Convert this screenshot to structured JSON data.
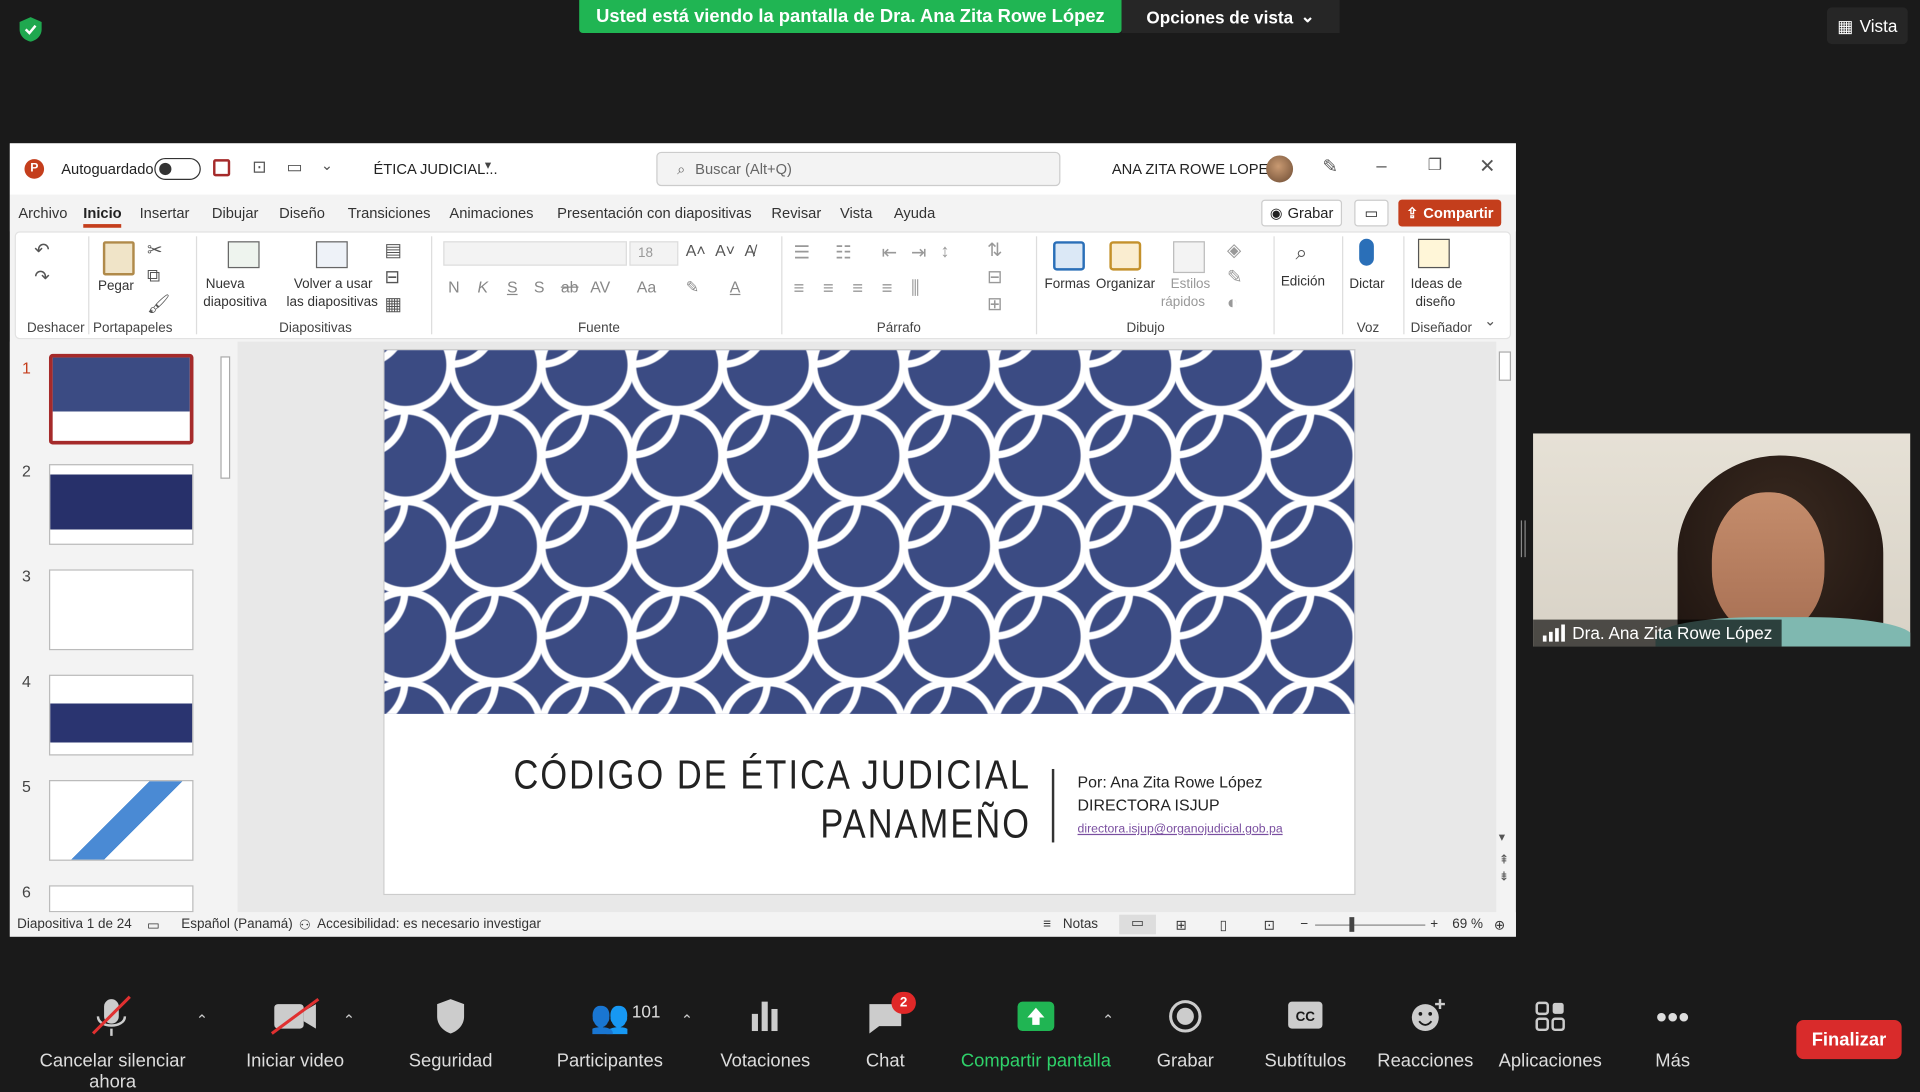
{
  "zoom": {
    "banner_text": "Usted está viendo la pantalla de Dra. Ana Zita Rowe López",
    "view_options": "Opciones de vista",
    "vista": "Vista",
    "participant_name": "Dra. Ana Zita Rowe López",
    "toolbar": [
      {
        "label": "Cancelar silenciar ahora",
        "icon": "mic-muted-icon"
      },
      {
        "label": "Iniciar video",
        "icon": "video-off-icon"
      },
      {
        "label": "Seguridad",
        "icon": "shield-icon"
      },
      {
        "label": "Participantes",
        "icon": "participants-icon",
        "count": "101"
      },
      {
        "label": "Votaciones",
        "icon": "poll-icon"
      },
      {
        "label": "Chat",
        "icon": "chat-icon",
        "badge": "2"
      },
      {
        "label": "Compartir pantalla",
        "icon": "share-screen-icon"
      },
      {
        "label": "Grabar",
        "icon": "record-icon"
      },
      {
        "label": "Subtítulos",
        "icon": "cc-icon"
      },
      {
        "label": "Reacciones",
        "icon": "reactions-icon"
      },
      {
        "label": "Aplicaciones",
        "icon": "apps-icon"
      },
      {
        "label": "Más",
        "icon": "more-icon"
      }
    ],
    "end_button": "Finalizar",
    "colors": {
      "share_green": "#20b553",
      "end_red": "#d92b2b"
    }
  },
  "ppt": {
    "autosave": "Autoguardado",
    "doc_title": "ÉTICA JUDICIAL...",
    "search_placeholder": "Buscar (Alt+Q)",
    "user": "ANA ZITA  ROWE LOPEZ",
    "menu": [
      "Archivo",
      "Inicio",
      "Insertar",
      "Dibujar",
      "Diseño",
      "Transiciones",
      "Animaciones",
      "Presentación con diapositivas",
      "Revisar",
      "Vista",
      "Ayuda"
    ],
    "grabar": "Grabar",
    "compartir": "Compartir",
    "ribbon": {
      "groups": [
        "Deshacer",
        "Portapapeles",
        "Diapositivas",
        "Fuente",
        "Párrafo",
        "Dibujo",
        "Voz",
        "Diseñador"
      ],
      "pegar": "Pegar",
      "nueva": "Nueva",
      "diapositiva": "diapositiva",
      "volver1": "Volver a usar",
      "volver2": "las diapositivas",
      "font_size": "18",
      "formas": "Formas",
      "organizar": "Organizar",
      "estilos1": "Estilos",
      "estilos2": "rápidos",
      "edicion": "Edición",
      "dictar": "Dictar",
      "ideas1": "Ideas de",
      "ideas2": "diseño",
      "font_buttons": [
        "N",
        "K",
        "S",
        "S",
        "ab",
        "AV",
        "Aa",
        "A"
      ]
    },
    "thumb_numbers": [
      "1",
      "2",
      "3",
      "4",
      "5",
      "6"
    ],
    "slide": {
      "title_line1": "CÓDIGO DE ÉTICA JUDICIAL",
      "title_line2": "PANAMEÑO",
      "by": "Por: Ana Zita Rowe López",
      "role": "DIRECTORA ISJUP",
      "email": "directora.isjup@organojudicial.gob.pa"
    },
    "status": {
      "slide_info": "Diapositiva 1 de 24",
      "language": "Español (Panamá)",
      "accessibility": "Accesibilidad: es necesario investigar",
      "notas": "Notas",
      "zoom": "69 %"
    },
    "colors": {
      "accent": "#c43e1c",
      "slide_blue": "#3b4b83"
    }
  }
}
